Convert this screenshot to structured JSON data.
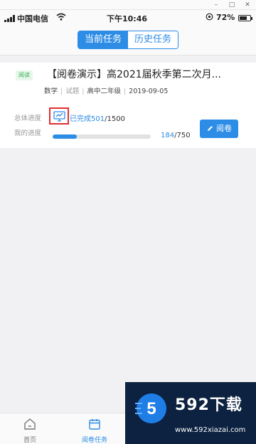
{
  "window_controls": {
    "minimize": "–",
    "maximize": "□",
    "close": "✕"
  },
  "status_bar": {
    "carrier": "中国电信",
    "time": "下午10:46",
    "battery_pct": "72%",
    "battery_level": 0.72,
    "wifi_icon": "wifi-icon",
    "location_icon": "location-icon"
  },
  "tabs": [
    {
      "label": "当前任务",
      "active": true
    },
    {
      "label": "历史任务",
      "active": false
    }
  ],
  "task": {
    "tag": "阅读",
    "title": "【阅卷演示】高2021届秋季第二次月...",
    "subject": "数学",
    "type": "试题",
    "grade": "高中二年级",
    "date": "2019-09-05",
    "overall_label": "总体进度",
    "overall_prefix": "已完成",
    "overall_done": "501",
    "overall_total": "/1500",
    "mine_label": "我的进度",
    "mine_done": "184",
    "mine_total": "/750",
    "mine_fraction": 0.245,
    "mark_button": "阅卷"
  },
  "bottom_nav": [
    {
      "label": "首页",
      "icon": "home-icon"
    },
    {
      "label": "阅卷任务",
      "icon": "calendar-icon"
    }
  ],
  "watermark": {
    "brand": "592下载",
    "url": "www.592xiazai.com",
    "logo_char": "5"
  },
  "colors": {
    "accent": "#2c8ce6",
    "tag_green": "#3cb055",
    "highlight_red": "#e03030"
  }
}
